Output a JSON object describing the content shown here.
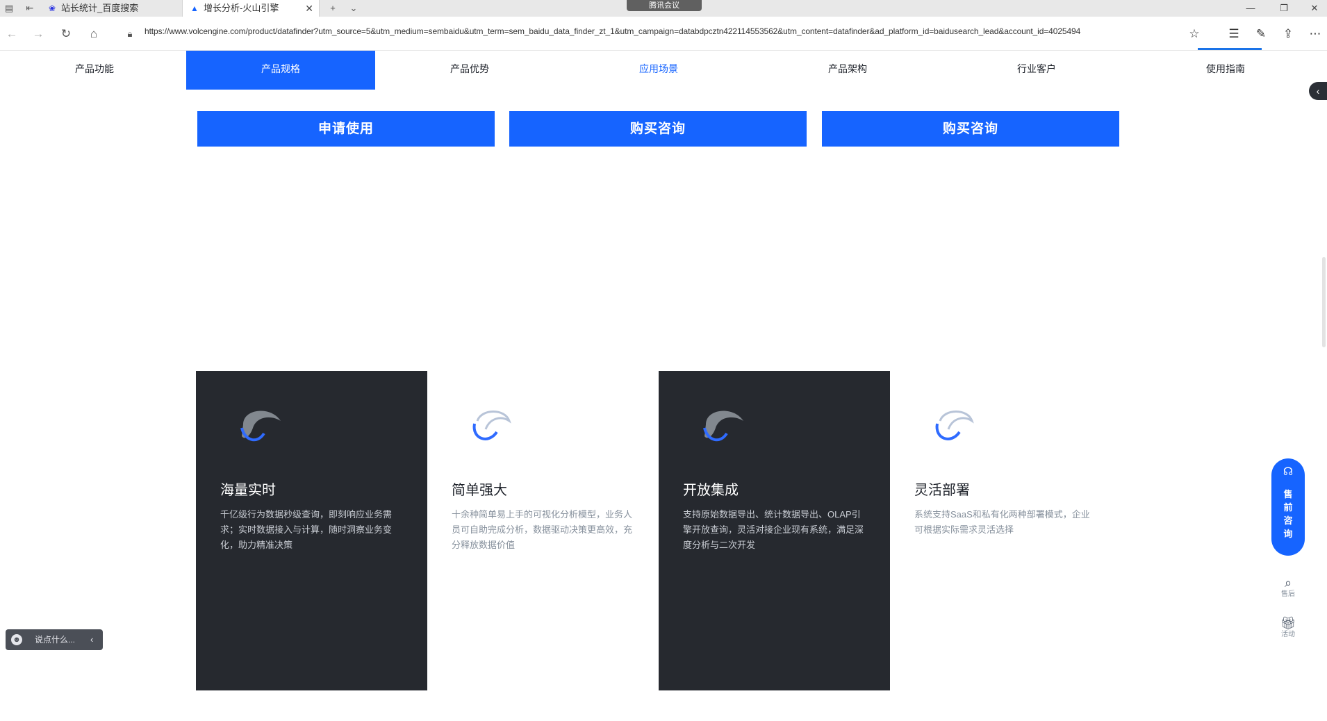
{
  "browser": {
    "tabs": [
      {
        "label": "站长统计_百度搜索",
        "icon": "paw-icon"
      },
      {
        "label": "增长分析-火山引擎",
        "icon": "volcano-icon"
      }
    ],
    "meeting_badge": "腾讯会议",
    "url": "https://www.volcengine.com/product/datafinder?utm_source=5&utm_medium=sembaidu&utm_term=sem_baidu_data_finder_zt_1&utm_campaign=databdpcztn422114553562&utm_content=datafinder&ad_platform_id=baidusearch_lead&account_id=4025494",
    "accent": "#1a73e8"
  },
  "nav": {
    "items": [
      "产品功能",
      "产品规格",
      "产品优势",
      "应用场景",
      "产品架构",
      "行业客户",
      "使用指南"
    ],
    "active": "产品规格",
    "accent": "#1664ff"
  },
  "cta": {
    "apply": "申请使用",
    "buy_consult_1": "购买咨询",
    "buy_consult_2": "购买咨询"
  },
  "cards": [
    {
      "title": "海量实时",
      "desc": "千亿级行为数据秒级查询，即刻响应业务需求；实时数据接入与计算，随时洞察业务变化，助力精准决策",
      "theme": "dark"
    },
    {
      "title": "简单强大",
      "desc": "十余种简单易上手的可视化分析模型，业务人员可自助完成分析，数据驱动决策更高效，充分释放数据价值",
      "theme": "light"
    },
    {
      "title": "开放集成",
      "desc": "支持原始数据导出、统计数据导出、OLAP引擎开放查询，灵活对接企业现有系统，满足深度分析与二次开发",
      "theme": "dark"
    },
    {
      "title": "灵活部署",
      "desc": "系统支持SaaS和私有化两种部署模式，企业可根据实际需求灵活选择",
      "theme": "light"
    }
  ],
  "floating": {
    "consult_label": "售前咨询",
    "tool1": "售后",
    "tool2": "活动"
  },
  "chat": {
    "placeholder": "说点什么..."
  }
}
